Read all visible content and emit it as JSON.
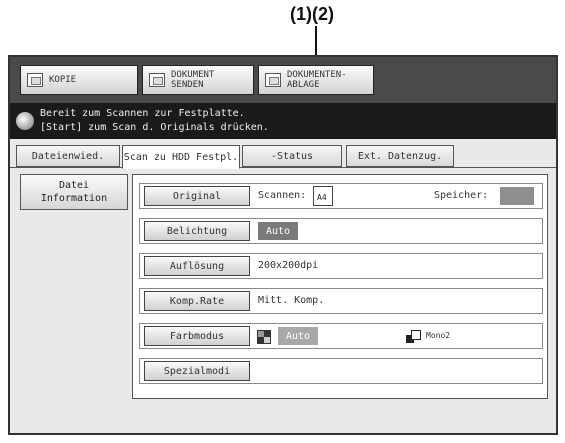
{
  "callout": {
    "label": "(1)(2)"
  },
  "modes": [
    {
      "label": "KOPIE"
    },
    {
      "label": "DOKUMENT\nSENDEN"
    },
    {
      "label": "DOKUMENTEN-\nABLAGE"
    }
  ],
  "message": {
    "line1": "Bereit zum Scannen zur Festplatte.",
    "line2": "[Start] zum Scan d. Originals drücken."
  },
  "tabs": [
    {
      "label": "Dateienwied."
    },
    {
      "label": "Scan zu HDD Festpl."
    },
    {
      "label": "-Status"
    },
    {
      "label": "Ext. Datenzug."
    }
  ],
  "sidebar": {
    "file_info": "Datei\nInformation"
  },
  "settings": {
    "original": {
      "button": "Original",
      "scan_label": "Scannen:",
      "paper_size": "A4",
      "memory_label": "Speicher:"
    },
    "exposure": {
      "button": "Belichtung",
      "value": "Auto"
    },
    "resolution": {
      "button": "Auflösung",
      "value": "200x200dpi"
    },
    "compression": {
      "button": "Komp.Rate",
      "value": "Mitt. Komp."
    },
    "color_mode": {
      "button": "Farbmodus",
      "color_value": "Auto",
      "mono_value": "Mono2"
    },
    "special": {
      "button": "Spezialmodi"
    }
  },
  "colors": {
    "mode_bar": "#4a4a4a",
    "message_bar": "#1a1a1a",
    "auto_chip": "#7a7a7a",
    "memory_indicator": "#8e8e8e"
  }
}
